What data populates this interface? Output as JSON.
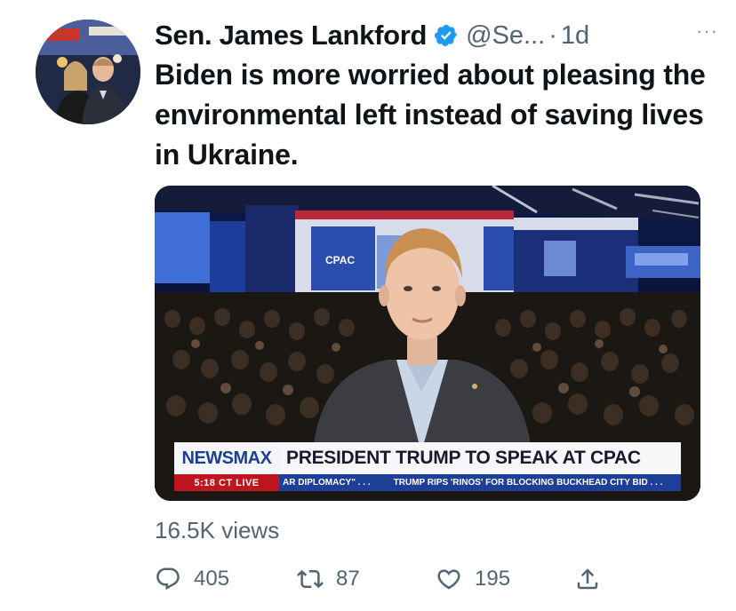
{
  "author": {
    "display_name": "Sen. James Lankford",
    "handle": "@Se...",
    "separator": "·",
    "time": "1d",
    "more": "···"
  },
  "tweet": {
    "text": "Biden is more worried about pleasing the environmental left instead of saving lives in Ukraine."
  },
  "media": {
    "logo": "NEWSMAX",
    "headline": "PRESIDENT TRUMP TO SPEAK AT CPAC",
    "time_live": "5:18 CT  LIVE",
    "ticker_a": "AR DIPLOMACY\" . . .",
    "ticker_b": "TRUMP RIPS 'RINOS' FOR BLOCKING BUCKHEAD CITY BID . . .",
    "stage_sign": "CPAC"
  },
  "stats": {
    "views_count": "16.5K",
    "views_label": "views"
  },
  "actions": {
    "replies": "405",
    "retweets": "87",
    "likes": "195"
  },
  "colors": {
    "text": "#0f1419",
    "secondary": "#536471",
    "verified": "#1d9bf0",
    "newsmax_red": "#c0141f",
    "newsmax_blue": "#1e3f98"
  },
  "icons": [
    "verified-badge-icon",
    "more-options-icon",
    "reply-icon",
    "retweet-icon",
    "like-icon",
    "share-icon"
  ]
}
